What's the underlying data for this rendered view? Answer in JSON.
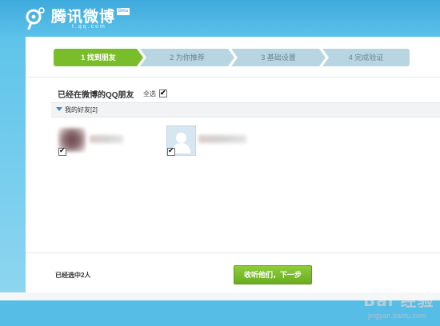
{
  "brand": {
    "title": "腾讯微博",
    "beta": "Beta",
    "domain": "t.qq.com"
  },
  "steps": [
    {
      "label": "1 找到朋友",
      "active": true
    },
    {
      "label": "2 为你推荐",
      "active": false
    },
    {
      "label": "3 基础设置",
      "active": false
    },
    {
      "label": "4 完成验证",
      "active": false
    }
  ],
  "section": {
    "title": "已经在微博的QQ朋友",
    "select_all_label": "全选",
    "select_all_checked": true
  },
  "group": {
    "label": "我的好友[2]",
    "expanded": true
  },
  "friends": [
    {
      "name": "",
      "avatar": "blurred-photo",
      "checked": true
    },
    {
      "name": "",
      "avatar": "default-user-icon",
      "checked": true
    }
  ],
  "footer": {
    "selected_text": "已经选中2人",
    "next_button": "收听他们，下一步"
  },
  "watermark": {
    "logo": "Bai  经验",
    "url": "jingyan.baidu.com"
  },
  "colors": {
    "header_blue": "#3ea9dc",
    "active_step_green": "#79bd2a",
    "inactive_step": "#b7d6e1",
    "button_green": "#69ad1f"
  }
}
